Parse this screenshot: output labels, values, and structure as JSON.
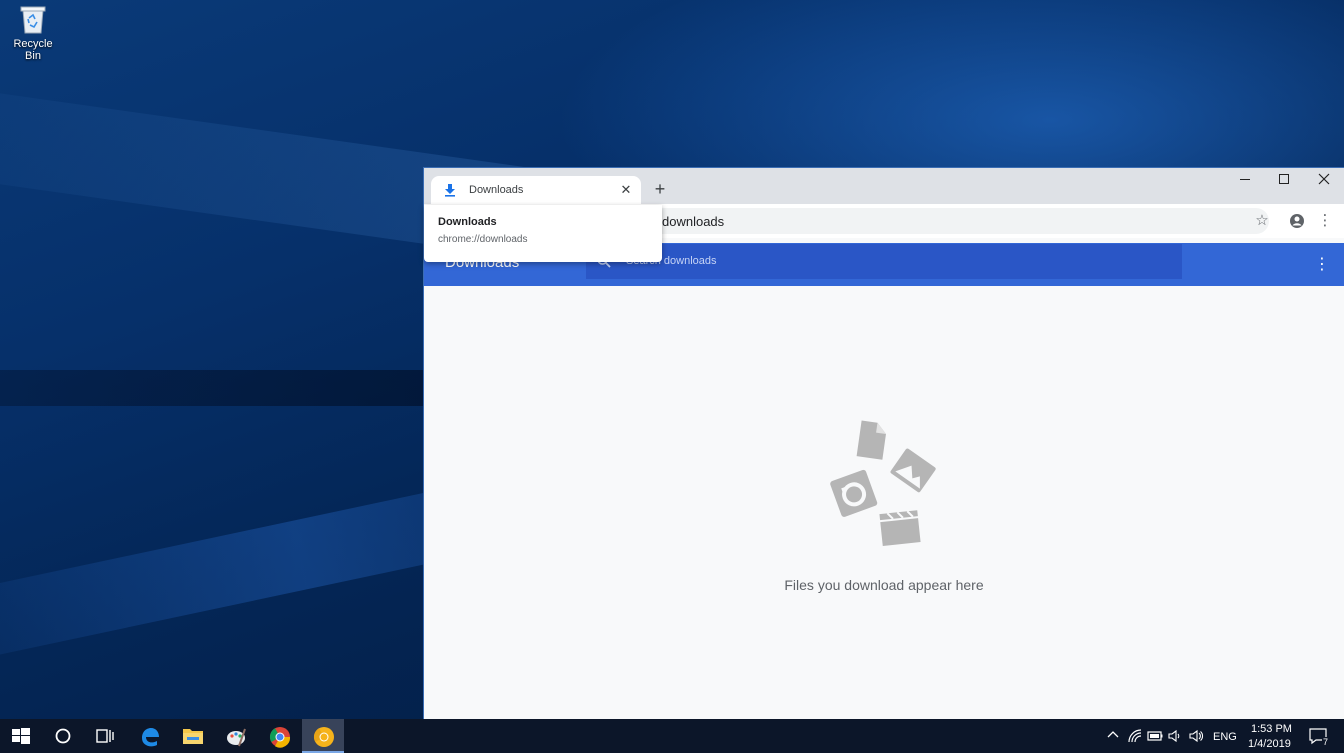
{
  "desktop": {
    "icons": [
      {
        "label": "Recycle Bin",
        "icon": "recycle-bin-icon"
      }
    ]
  },
  "browser": {
    "tab": {
      "title": "Downloads",
      "icon": "download-icon"
    },
    "address_text": "downloads",
    "tooltip": {
      "title": "Downloads",
      "url": "chrome://downloads"
    },
    "page": {
      "header_title": "Downloads",
      "search_placeholder": "Search downloads",
      "empty_message": "Files you download appear here"
    }
  },
  "taskbar": {
    "items": [
      "start-icon",
      "cortana-icon",
      "task-view-icon",
      "edge-icon",
      "file-explorer-icon",
      "paint-icon",
      "chrome-icon",
      "chrome-canary-icon"
    ],
    "active_item": "chrome-canary-icon",
    "tray": {
      "language": "ENG",
      "time": "1:53 PM",
      "date": "1/4/2019",
      "notification_count": "7"
    }
  },
  "colors": {
    "accent": "#3367d6",
    "search_bg": "#2a56c6",
    "taskbar": "#0c1629"
  }
}
